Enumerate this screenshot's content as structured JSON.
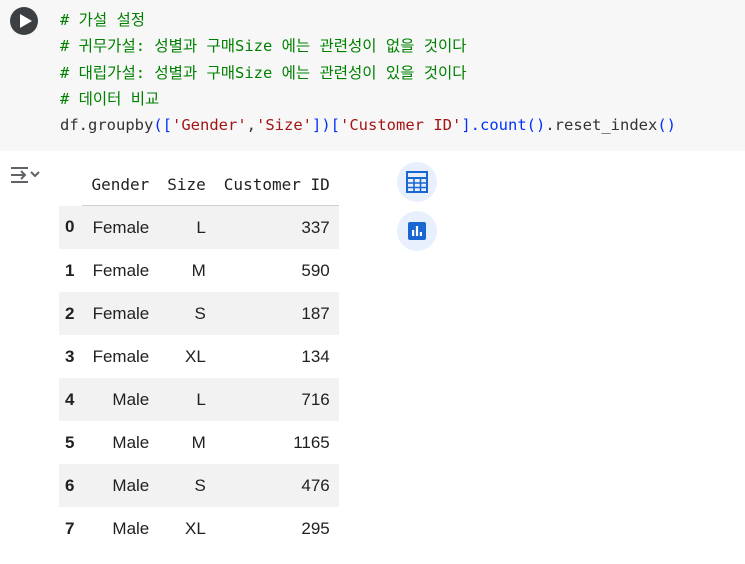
{
  "code_cell": {
    "run_button": "run-cell",
    "lines": {
      "l1": "# 가설 설정",
      "l2": "# 귀무가설: 성별과 구매Size 에는 관련성이 없을 것이다",
      "l3": "# 대립가설: 성별과 구매Size 에는 관련성이 있을 것이다",
      "l4": "# 데이터 비교",
      "l5": {
        "a": "df.groupby",
        "b": "([",
        "c": "'Gender'",
        "d": ",",
        "e": "'Size'",
        "f": "])[",
        "g": "'Customer ID'",
        "h": "].count",
        "i": "()",
        "j": ".reset_index",
        "k": "()"
      }
    }
  },
  "output": {
    "toggle_icon": "output-toggle-icon",
    "table": {
      "columns": {
        "c0": "Gender",
        "c1": "Size",
        "c2": "Customer ID"
      },
      "rows": [
        {
          "idx": "0",
          "gender": "Female",
          "size": "L",
          "count": "337"
        },
        {
          "idx": "1",
          "gender": "Female",
          "size": "M",
          "count": "590"
        },
        {
          "idx": "2",
          "gender": "Female",
          "size": "S",
          "count": "187"
        },
        {
          "idx": "3",
          "gender": "Female",
          "size": "XL",
          "count": "134"
        },
        {
          "idx": "4",
          "gender": "Male",
          "size": "L",
          "count": "716"
        },
        {
          "idx": "5",
          "gender": "Male",
          "size": "M",
          "count": "1165"
        },
        {
          "idx": "6",
          "gender": "Male",
          "size": "S",
          "count": "476"
        },
        {
          "idx": "7",
          "gender": "Male",
          "size": "XL",
          "count": "295"
        }
      ]
    },
    "actions": {
      "table_icon": "interactive-table-icon",
      "chart_icon": "suggest-chart-icon"
    }
  },
  "colors": {
    "cell_bg": "#f7f7f7",
    "comment": "#008000",
    "string": "#a31515",
    "bracket": "#0431fa",
    "accent": "#1967d2",
    "accent_bg": "#e8f0fe",
    "row_stripe": "#f2f2f2"
  }
}
